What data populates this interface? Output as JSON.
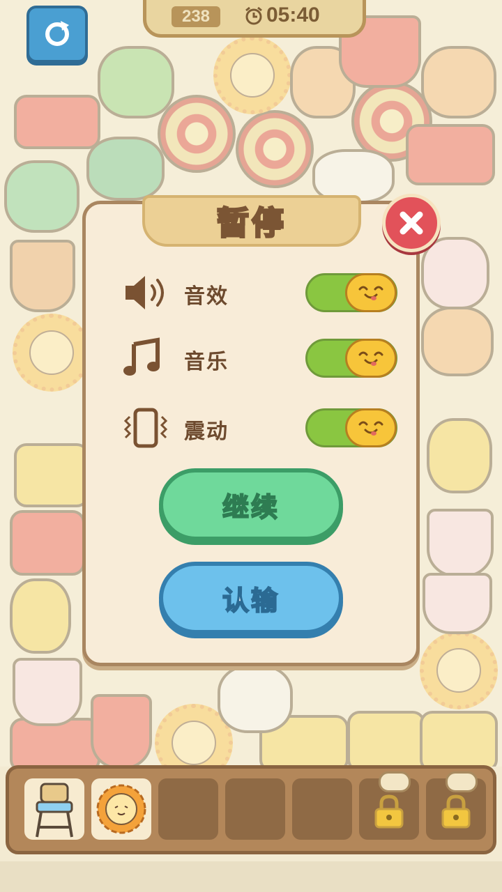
{
  "hud": {
    "level": "238",
    "timer": "05:40",
    "refresh_icon": "refresh-icon",
    "clock_icon": "alarm-clock-icon"
  },
  "dialog": {
    "title": "暂停",
    "close_icon": "close-icon",
    "settings": [
      {
        "label": "音效",
        "icon": "speaker-icon",
        "enabled": true
      },
      {
        "label": "音乐",
        "icon": "music-note-icon",
        "enabled": true
      },
      {
        "label": "震动",
        "icon": "vibrate-icon",
        "enabled": true
      }
    ],
    "continue_label": "继续",
    "giveup_label": "认输"
  },
  "tray": {
    "slots": [
      {
        "state": "filled",
        "item": "high-chair"
      },
      {
        "state": "filled",
        "item": "sunflower"
      },
      {
        "state": "empty"
      },
      {
        "state": "empty"
      },
      {
        "state": "empty"
      },
      {
        "state": "locked",
        "icon": "lock-icon"
      },
      {
        "state": "locked",
        "icon": "lock-icon"
      }
    ]
  },
  "colors": {
    "toggle_on": "#8ac641",
    "continue_button": "#6fd99b",
    "giveup_button": "#6dc1ec",
    "close_button": "#e2525a",
    "dialog_bg": "#f8ecd8"
  }
}
